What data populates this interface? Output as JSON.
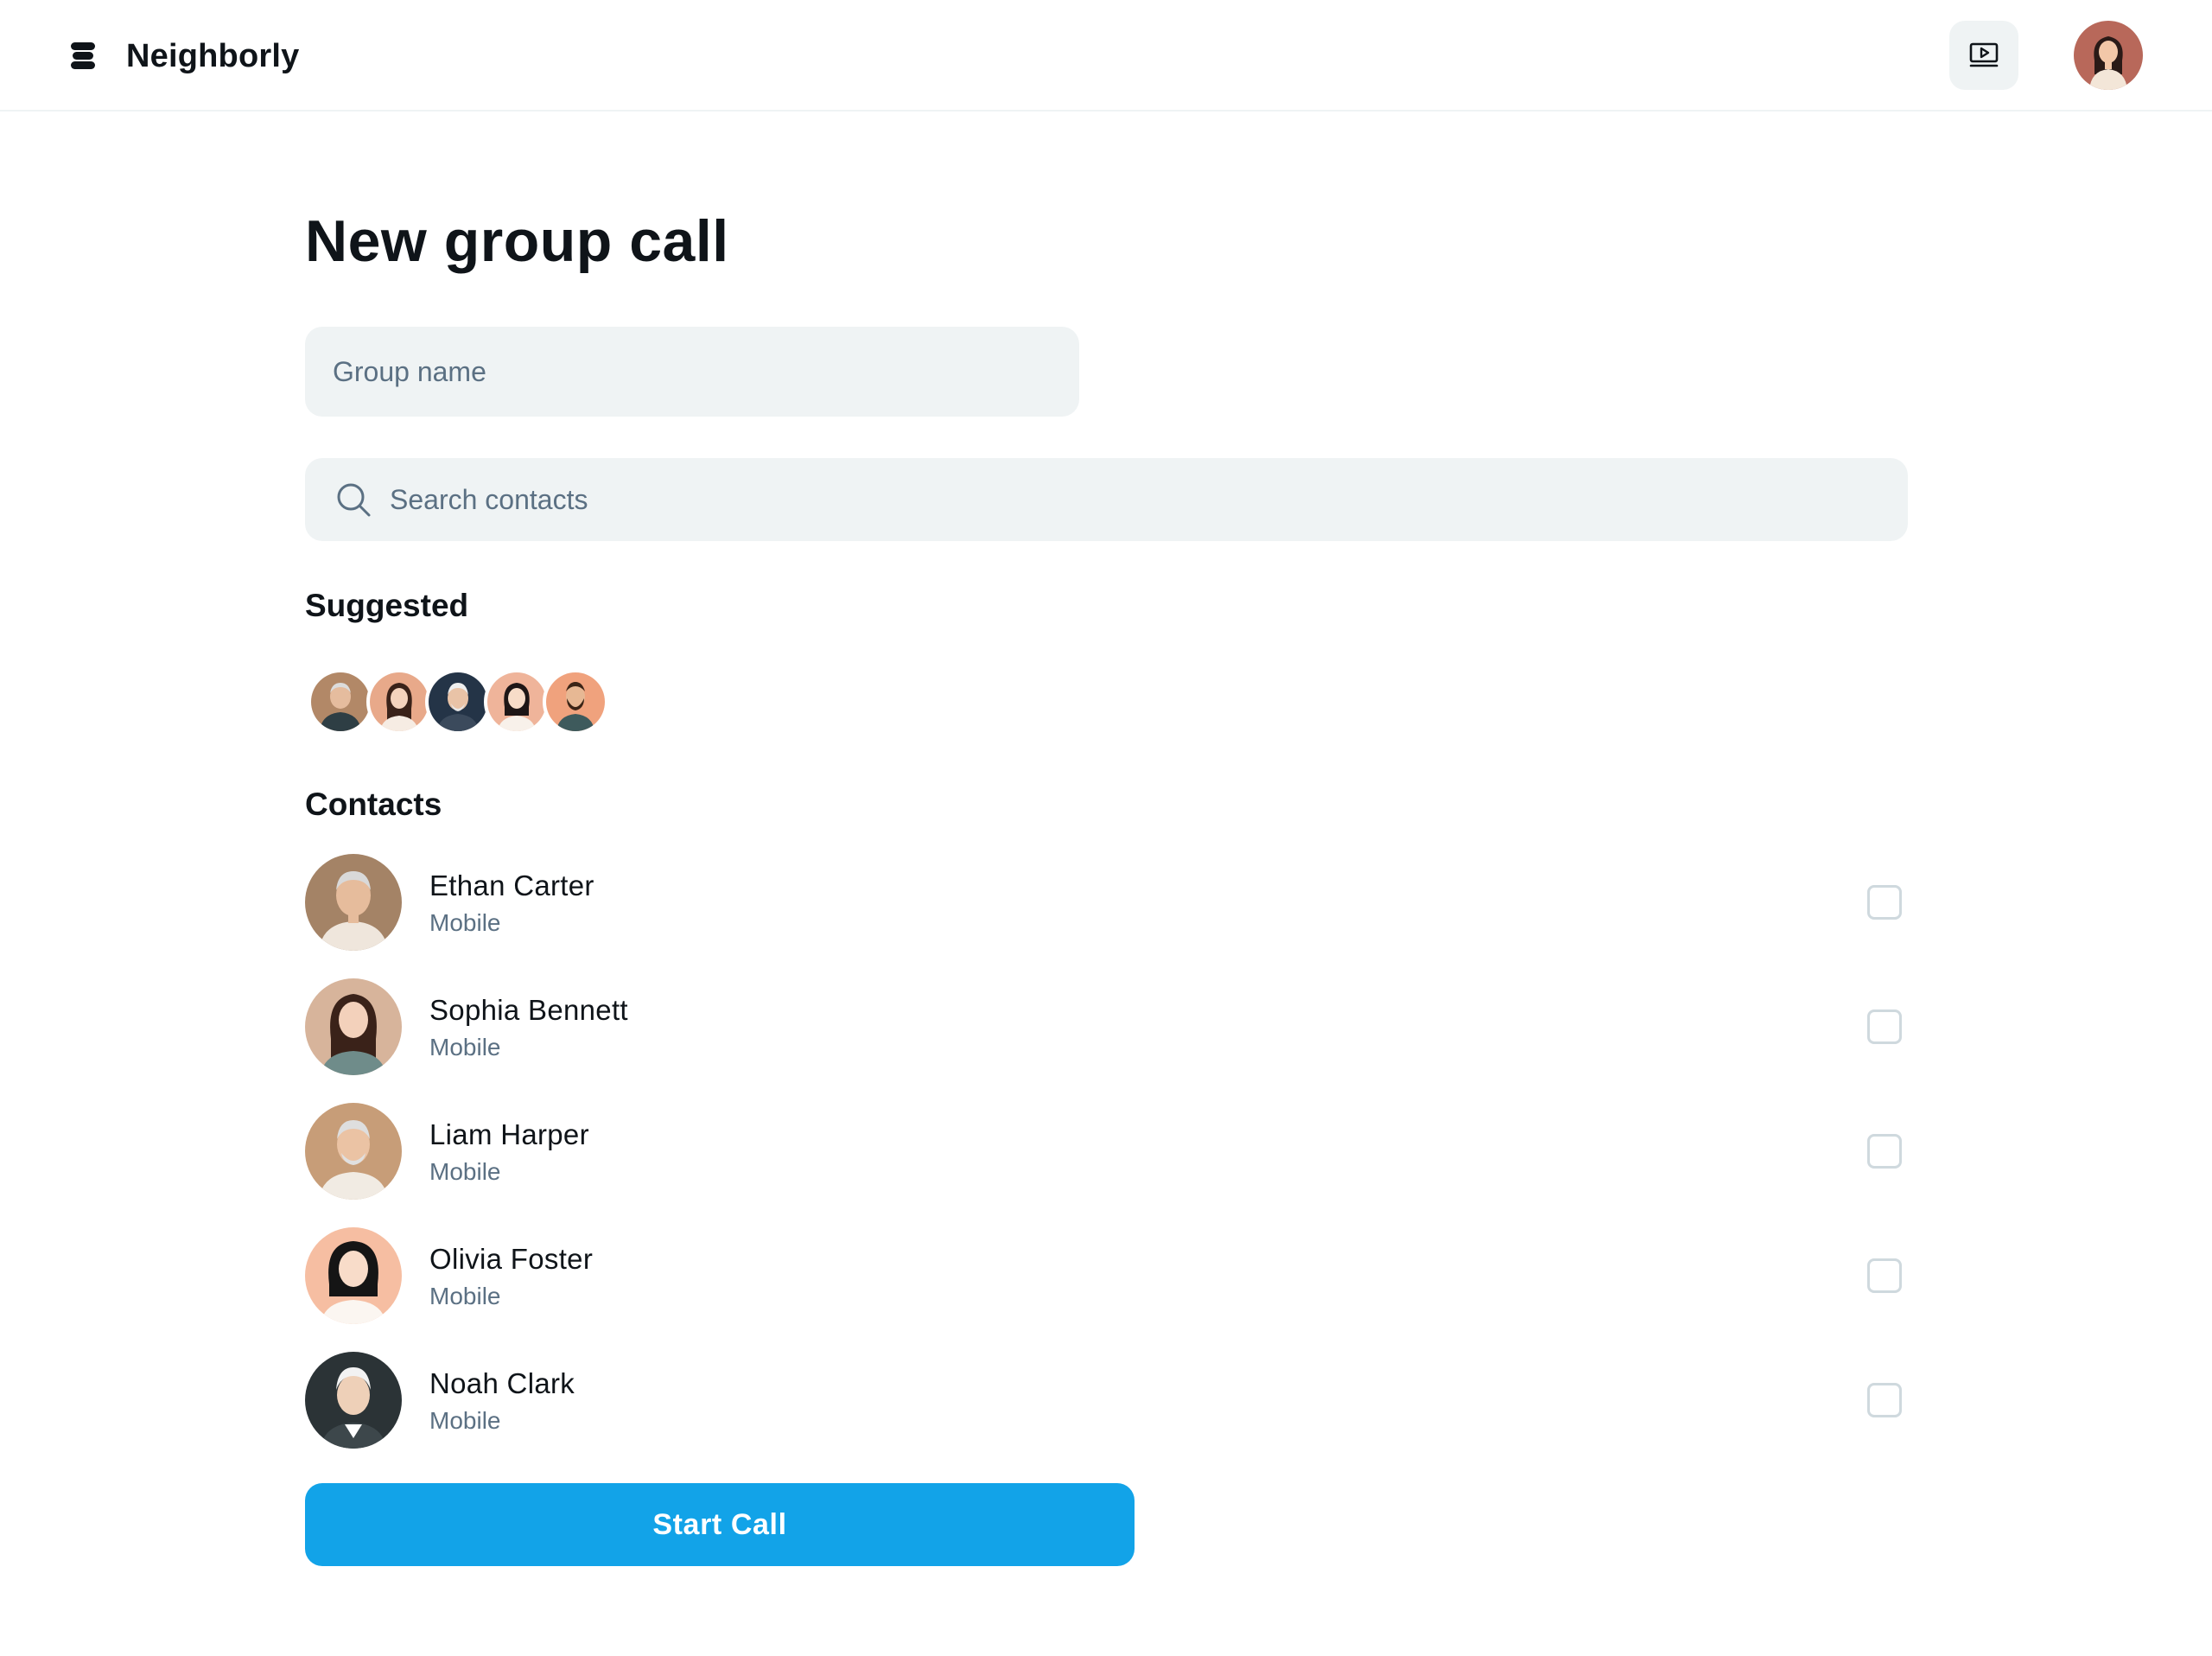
{
  "header": {
    "brand_name": "Neighborly",
    "icons": {
      "logo": "stacked-coins-logo-icon",
      "video": "video-play-icon",
      "avatar": "user-avatar"
    }
  },
  "page": {
    "title": "New group call"
  },
  "group_name": {
    "placeholder": "Group name",
    "value": ""
  },
  "search": {
    "placeholder": "Search contacts",
    "value": "",
    "icon": "search-icon"
  },
  "suggested": {
    "title": "Suggested",
    "avatars": [
      "avatar-older-man",
      "avatar-woman-long-hair",
      "avatar-older-man-dark-bg",
      "avatar-woman-dark-hair",
      "avatar-bearded-man"
    ]
  },
  "contacts": {
    "title": "Contacts",
    "items": [
      {
        "name": "Ethan Carter",
        "type": "Mobile",
        "checked": false
      },
      {
        "name": "Sophia Bennett",
        "type": "Mobile",
        "checked": false
      },
      {
        "name": "Liam Harper",
        "type": "Mobile",
        "checked": false
      },
      {
        "name": "Olivia Foster",
        "type": "Mobile",
        "checked": false
      },
      {
        "name": "Noah Clark",
        "type": "Mobile",
        "checked": false
      }
    ]
  },
  "actions": {
    "start_label": "Start Call"
  },
  "colors": {
    "accent": "#12a3e8",
    "input_bg": "#eff3f4",
    "muted_text": "#5b7083",
    "text": "#0f1419"
  }
}
